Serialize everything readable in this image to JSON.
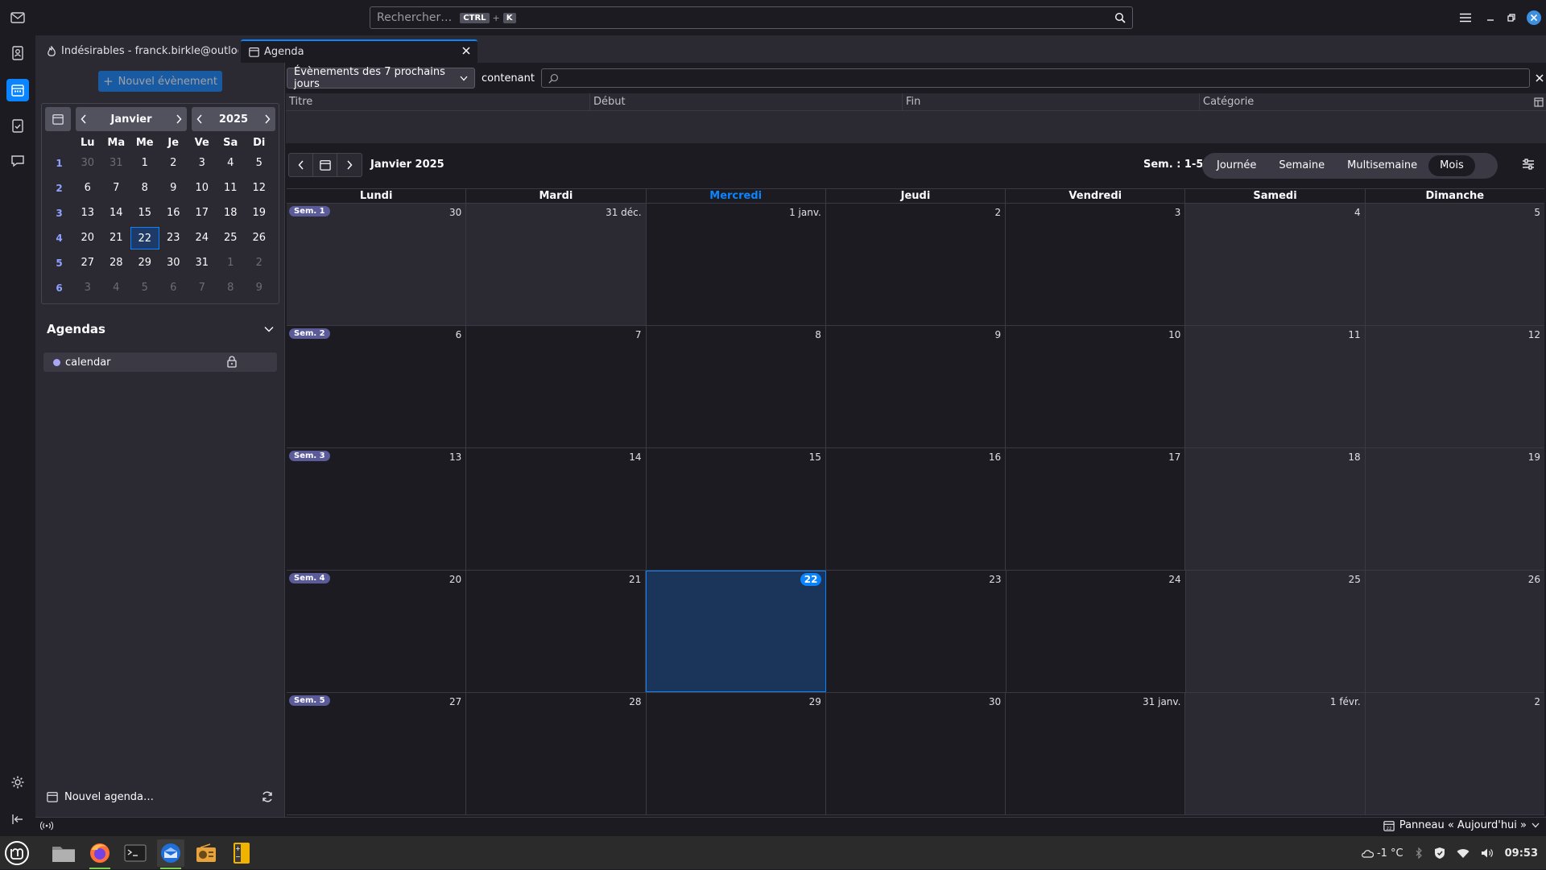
{
  "search": {
    "placeholder": "Rechercher…",
    "shortcut_mod": "CTRL",
    "shortcut_plus": "+",
    "shortcut_key": "K"
  },
  "tabs": [
    {
      "label": "Indésirables - franck.birkle@outlook.fr"
    },
    {
      "label": "Agenda"
    }
  ],
  "left": {
    "new_event": "Nouvel évènement",
    "mini_month": "Janvier",
    "mini_year": "2025",
    "weekday_headers": [
      "Lu",
      "Ma",
      "Me",
      "Je",
      "Ve",
      "Sa",
      "Di"
    ],
    "weeks": [
      {
        "wk": "1",
        "days": [
          "30",
          "31",
          "1",
          "2",
          "3",
          "4",
          "5"
        ]
      },
      {
        "wk": "2",
        "days": [
          "6",
          "7",
          "8",
          "9",
          "10",
          "11",
          "12"
        ]
      },
      {
        "wk": "3",
        "days": [
          "13",
          "14",
          "15",
          "16",
          "17",
          "18",
          "19"
        ]
      },
      {
        "wk": "4",
        "days": [
          "20",
          "21",
          "22",
          "23",
          "24",
          "25",
          "26"
        ]
      },
      {
        "wk": "5",
        "days": [
          "27",
          "28",
          "29",
          "30",
          "31",
          "1",
          "2"
        ]
      },
      {
        "wk": "6",
        "days": [
          "3",
          "4",
          "5",
          "6",
          "7",
          "8",
          "9"
        ]
      }
    ],
    "agendas_title": "Agendas",
    "calendar_name": "calendar",
    "new_agenda": "Nouvel agenda…"
  },
  "filter": {
    "select": "Évènements des 7 prochains jours",
    "containing": "contenant"
  },
  "list_columns": [
    "Titre",
    "Début",
    "Fin",
    "Catégorie"
  ],
  "calendar": {
    "month_label": "Janvier 2025",
    "week_range": "Sem. : 1-5",
    "views": [
      "Journée",
      "Semaine",
      "Multisemaine",
      "Mois"
    ],
    "selected_view": "Mois",
    "day_headers": [
      "Lundi",
      "Mardi",
      "Mercredi",
      "Jeudi",
      "Vendredi",
      "Samedi",
      "Dimanche"
    ],
    "weeks": [
      {
        "badge": "Sem. 1",
        "days": [
          "30",
          "31 déc.",
          "1 janv.",
          "2",
          "3",
          "4",
          "5"
        ]
      },
      {
        "badge": "Sem. 2",
        "days": [
          "6",
          "7",
          "8",
          "9",
          "10",
          "11",
          "12"
        ]
      },
      {
        "badge": "Sem. 3",
        "days": [
          "13",
          "14",
          "15",
          "16",
          "17",
          "18",
          "19"
        ]
      },
      {
        "badge": "Sem. 4",
        "days": [
          "20",
          "21",
          "22",
          "23",
          "24",
          "25",
          "26"
        ]
      },
      {
        "badge": "Sem. 5",
        "days": [
          "27",
          "28",
          "29",
          "30",
          "31 janv.",
          "1 févr.",
          "2"
        ]
      }
    ]
  },
  "statusbar": {
    "today_pane": "Panneau « Aujourd'hui »"
  },
  "tray": {
    "temperature": "-1 °C",
    "time": "09:53"
  },
  "colors": {
    "accent": "#0a84ff",
    "week_badge": "#5b5b9a",
    "calendar_dot": "#a8a6f5"
  }
}
